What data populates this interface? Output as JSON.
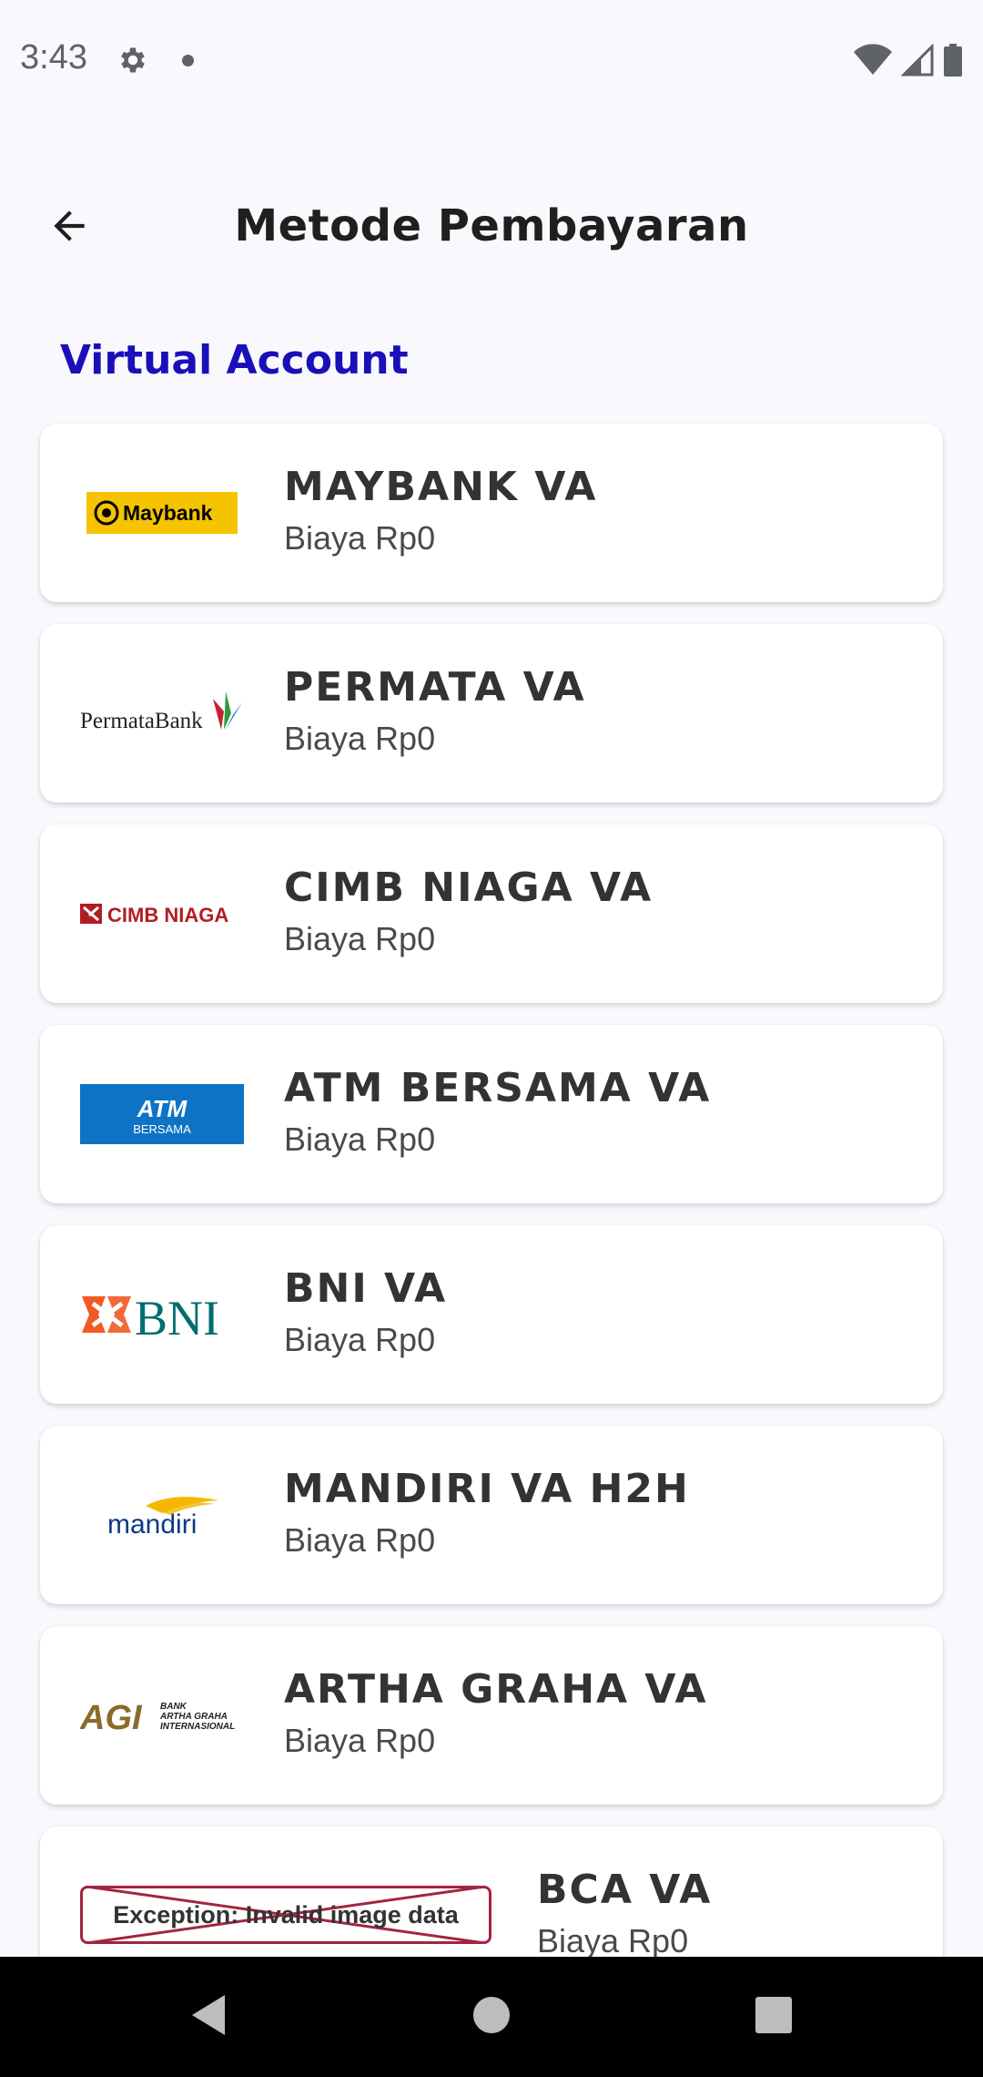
{
  "status_bar": {
    "time": "3:43",
    "icons": [
      "gear-icon",
      "notification-dot-icon",
      "wifi-icon",
      "signal-icon",
      "battery-icon"
    ]
  },
  "app_bar": {
    "title": "Metode Pembayaran",
    "back_icon": "arrow-left-icon"
  },
  "section": {
    "title": "Virtual Account",
    "accent_color": "#1a0fb8"
  },
  "payment_methods": [
    {
      "name": "MAYBANK VA",
      "fee": "Biaya Rp0",
      "logo": "maybank-logo",
      "logo_text": "Maybank"
    },
    {
      "name": "PERMATA VA",
      "fee": "Biaya Rp0",
      "logo": "permatabank-logo",
      "logo_text": "PermataBank"
    },
    {
      "name": "CIMB NIAGA VA",
      "fee": "Biaya Rp0",
      "logo": "cimb-niaga-logo",
      "logo_text": "CIMB NIAGA"
    },
    {
      "name": "ATM BERSAMA VA",
      "fee": "Biaya Rp0",
      "logo": "atm-bersama-logo",
      "logo_text": "ATM BERSAMA"
    },
    {
      "name": "BNI VA",
      "fee": "Biaya Rp0",
      "logo": "bni-logo",
      "logo_text": "BNI"
    },
    {
      "name": "MANDIRI VA H2H",
      "fee": "Biaya Rp0",
      "logo": "mandiri-logo",
      "logo_text": "mandiri"
    },
    {
      "name": "ARTHA GRAHA VA",
      "fee": "Biaya Rp0",
      "logo": "artha-graha-logo",
      "logo_text": "AGI BANK ARTHA GRAHA INTERNASIONAL"
    },
    {
      "name": "BCA VA",
      "fee": "Biaya Rp0",
      "logo": "image-error",
      "logo_text": "Exception: Invalid image data"
    }
  ],
  "nav_bar": {
    "back": "nav-back-icon",
    "home": "nav-home-icon",
    "recents": "nav-recents-icon"
  }
}
